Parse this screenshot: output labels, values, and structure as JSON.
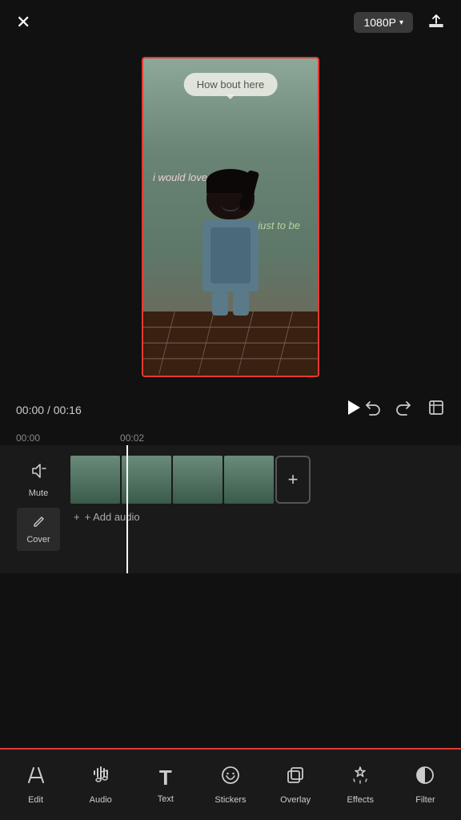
{
  "header": {
    "resolution_label": "1080P",
    "chevron": "▾",
    "close_label": "✕"
  },
  "preview": {
    "speech_bubble_text": "How bout here",
    "overlay_left": "i would\nlove ♥",
    "overlay_right": "just\nto be"
  },
  "playback": {
    "current_time": "00:00",
    "total_time": "00:16",
    "separator": "/"
  },
  "timeline": {
    "time_markers": [
      "00:00",
      "00:02"
    ],
    "mute_label": "Mute",
    "cover_label": "Cover",
    "add_audio_label": "+ Add audio"
  },
  "toolbar": {
    "items": [
      {
        "id": "edit",
        "icon": "✂",
        "label": "Edit"
      },
      {
        "id": "audio",
        "icon": "♪",
        "label": "Audio"
      },
      {
        "id": "text",
        "icon": "T",
        "label": "Text"
      },
      {
        "id": "stickers",
        "icon": "◕",
        "label": "Stickers"
      },
      {
        "id": "overlay",
        "icon": "▣",
        "label": "Overlay"
      },
      {
        "id": "effects",
        "icon": "✦",
        "label": "Effects"
      },
      {
        "id": "filter",
        "icon": "◑",
        "label": "Filter"
      }
    ]
  }
}
